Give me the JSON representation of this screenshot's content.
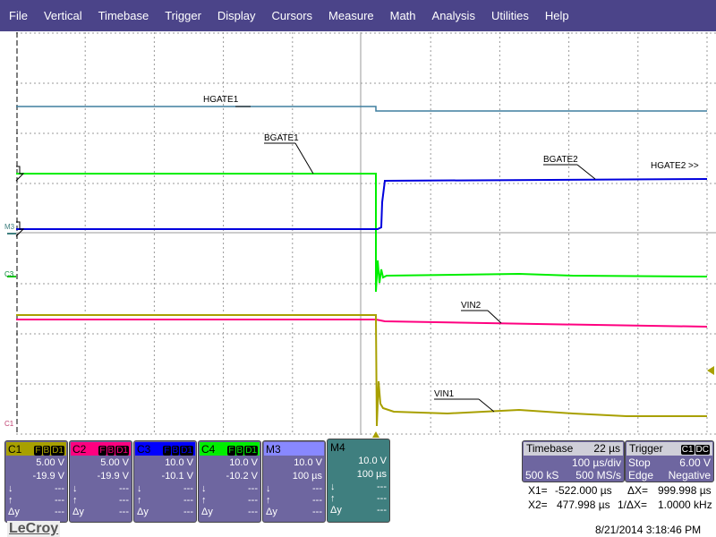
{
  "menu": [
    "File",
    "Vertical",
    "Timebase",
    "Trigger",
    "Display",
    "Cursors",
    "Measure",
    "Math",
    "Analysis",
    "Utilities",
    "Help"
  ],
  "trace_labels": {
    "hgate1": "HGATE1",
    "bgate1": "BGATE1",
    "bgate2": "BGATE2",
    "hgate2": "HGATE2 >>",
    "vin2": "VIN2",
    "vin1": "VIN1"
  },
  "markers": {
    "m3": "M3",
    "c3": "C3",
    "c1": "C1"
  },
  "channels": [
    {
      "name": "C1",
      "color": "#a8a000",
      "tags": [
        "F",
        "B",
        "D1"
      ],
      "scale": "5.00 V",
      "offset": "-19.9 V",
      "down": "---",
      "up": "---",
      "dy": "---"
    },
    {
      "name": "C2",
      "color": "#ff0080",
      "tags": [
        "F",
        "B",
        "D1"
      ],
      "scale": "5.00 V",
      "offset": "-19.9 V",
      "down": "---",
      "up": "---",
      "dy": "---"
    },
    {
      "name": "C3",
      "color": "#0000ff",
      "tags": [
        "F",
        "B",
        "D1"
      ],
      "scale": "10.0 V",
      "offset": "-10.1 V",
      "down": "---",
      "up": "---",
      "dy": "---"
    },
    {
      "name": "C4",
      "color": "#00ee00",
      "tags": [
        "F",
        "B",
        "D1"
      ],
      "scale": "10.0 V",
      "offset": "-10.2 V",
      "down": "---",
      "up": "---",
      "dy": "---"
    },
    {
      "name": "M3",
      "color": "#8888ff",
      "scale": "10.0 V",
      "offset": "100 µs",
      "down": "---",
      "up": "---",
      "dy": "---"
    },
    {
      "name": "M4",
      "color": "#3f7f7f",
      "scale": "10.0 V",
      "offset": "100 µs",
      "down": "---",
      "up": "---",
      "dy": "---"
    }
  ],
  "row_symbols": {
    "down": "↓",
    "up": "↑",
    "dy": "Δy"
  },
  "timebase": {
    "title": "Timebase",
    "delay": "22 µs",
    "per_div": "100 µs/div",
    "samples": "500 kS",
    "rate": "500 MS/s"
  },
  "trigger": {
    "title": "Trigger",
    "source": "C1",
    "coupling": "DC",
    "mode": "Stop",
    "level": "6.00 V",
    "type": "Edge",
    "slope": "Negative"
  },
  "cursors": {
    "x1_label": "X1=",
    "x1": "-522.000 µs",
    "dx_label": "ΔX=",
    "dx": "999.998 µs",
    "x2_label": "X2=",
    "x2": "477.998 µs",
    "inv_label": "1/ΔX=",
    "inv": "1.0000 kHz"
  },
  "timestamp": "8/21/2014 3:18:46 PM",
  "brand": "LeCroy"
}
